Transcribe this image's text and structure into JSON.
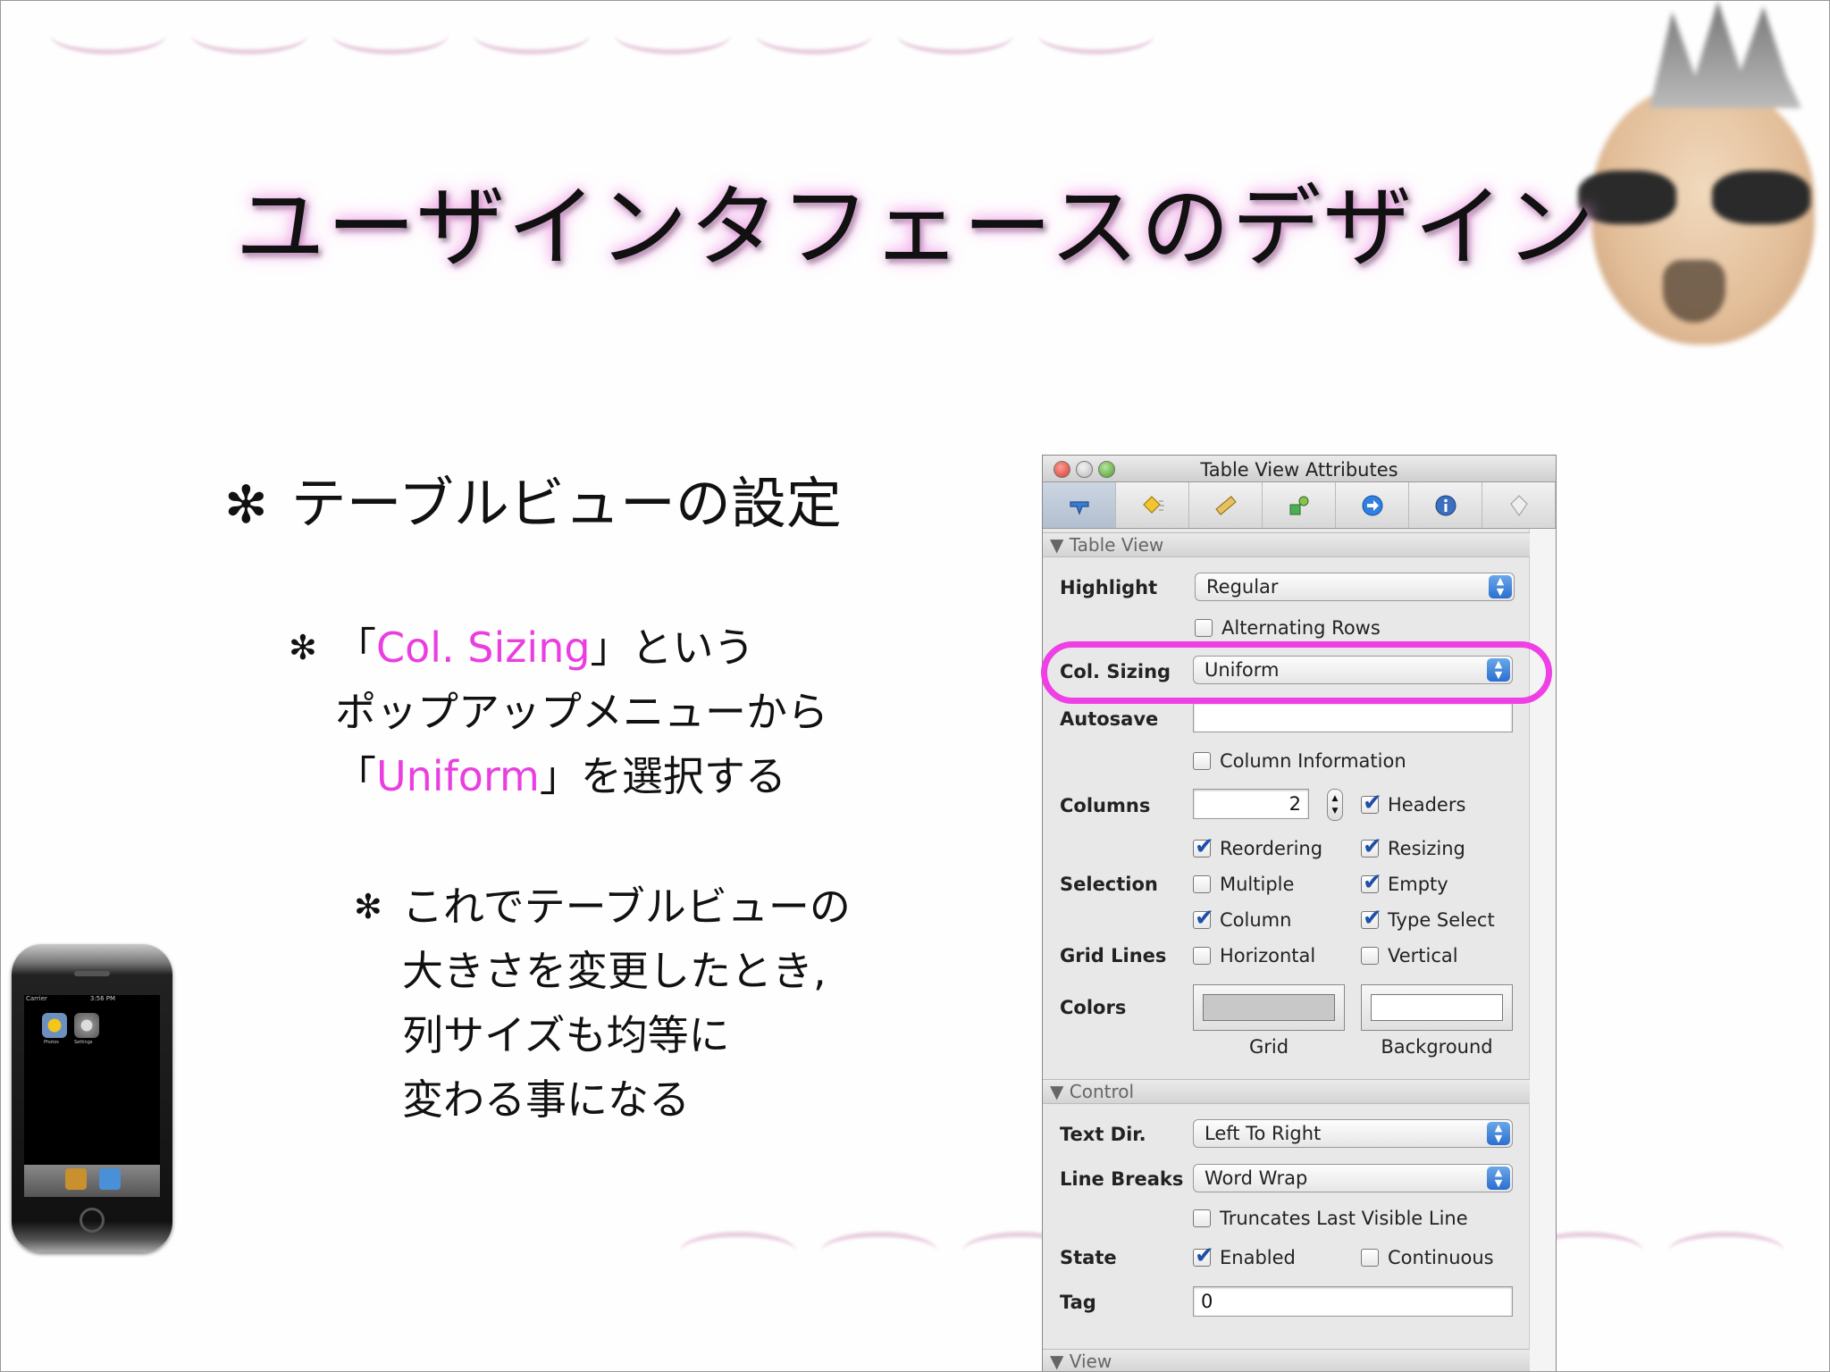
{
  "slide": {
    "title": "ユーザインタフェースのデザイン",
    "bullet1": {
      "marker": "✻",
      "text": "テーブルビューの設定"
    },
    "bullet2": {
      "marker": "✻",
      "l1_pre": "「",
      "l1_hl": "Col. Sizing",
      "l1_post": "」という",
      "l2": "ポップアップメニューから",
      "l3_pre": "「",
      "l3_hl": "Uniform",
      "l3_post": "」を選択する"
    },
    "bullet3": {
      "marker": "✻",
      "lines": [
        "これでテーブルビューの",
        "大きさを変更したとき,",
        "列サイズも均等に",
        "変わる事になる"
      ]
    },
    "highlight_color": "#ea3fe0"
  },
  "iphone": {
    "carrier": "Carrier",
    "time": "3:56 PM",
    "apps": [
      "Photos",
      "Settings"
    ],
    "dock": [
      "Contacts",
      "Safari"
    ]
  },
  "inspector": {
    "title": "Table View Attributes",
    "toolbar_icons": [
      "attributes-icon",
      "effects-icon",
      "size-icon",
      "bindings-icon",
      "connections-icon",
      "info-icon",
      "identity-icon"
    ],
    "sections": {
      "table_view": "▼ Table View",
      "control": "▼ Control",
      "view": "▼ View"
    },
    "highlight": {
      "label": "Highlight",
      "value": "Regular"
    },
    "alternating_rows": {
      "label": "Alternating Rows",
      "checked": false
    },
    "col_sizing": {
      "label": "Col. Sizing",
      "value": "Uniform"
    },
    "autosave": {
      "label": "Autosave",
      "value": ""
    },
    "column_information": {
      "label": "Column Information",
      "checked": false
    },
    "columns": {
      "label": "Columns",
      "value": "2"
    },
    "headers": {
      "label": "Headers",
      "checked": true
    },
    "reordering": {
      "label": "Reordering",
      "checked": true
    },
    "resizing": {
      "label": "Resizing",
      "checked": true
    },
    "selection": {
      "label": "Selection"
    },
    "multiple": {
      "label": "Multiple",
      "checked": false
    },
    "empty": {
      "label": "Empty",
      "checked": true
    },
    "column": {
      "label": "Column",
      "checked": true
    },
    "type_select": {
      "label": "Type Select",
      "checked": true
    },
    "grid_lines": {
      "label": "Grid Lines"
    },
    "horizontal": {
      "label": "Horizontal",
      "checked": false
    },
    "vertical": {
      "label": "Vertical",
      "checked": false
    },
    "colors": {
      "label": "Colors",
      "grid": "Grid",
      "background": "Background",
      "grid_color": "#c8c8c8",
      "background_color": "#ffffff"
    },
    "text_dir": {
      "label": "Text Dir.",
      "value": "Left To Right"
    },
    "line_breaks": {
      "label": "Line Breaks",
      "value": "Word Wrap"
    },
    "truncates": {
      "label": "Truncates Last Visible Line",
      "checked": false
    },
    "state": {
      "label": "State"
    },
    "enabled": {
      "label": "Enabled",
      "checked": true
    },
    "continuous": {
      "label": "Continuous",
      "checked": false
    },
    "tag": {
      "label": "Tag",
      "value": "0"
    }
  }
}
